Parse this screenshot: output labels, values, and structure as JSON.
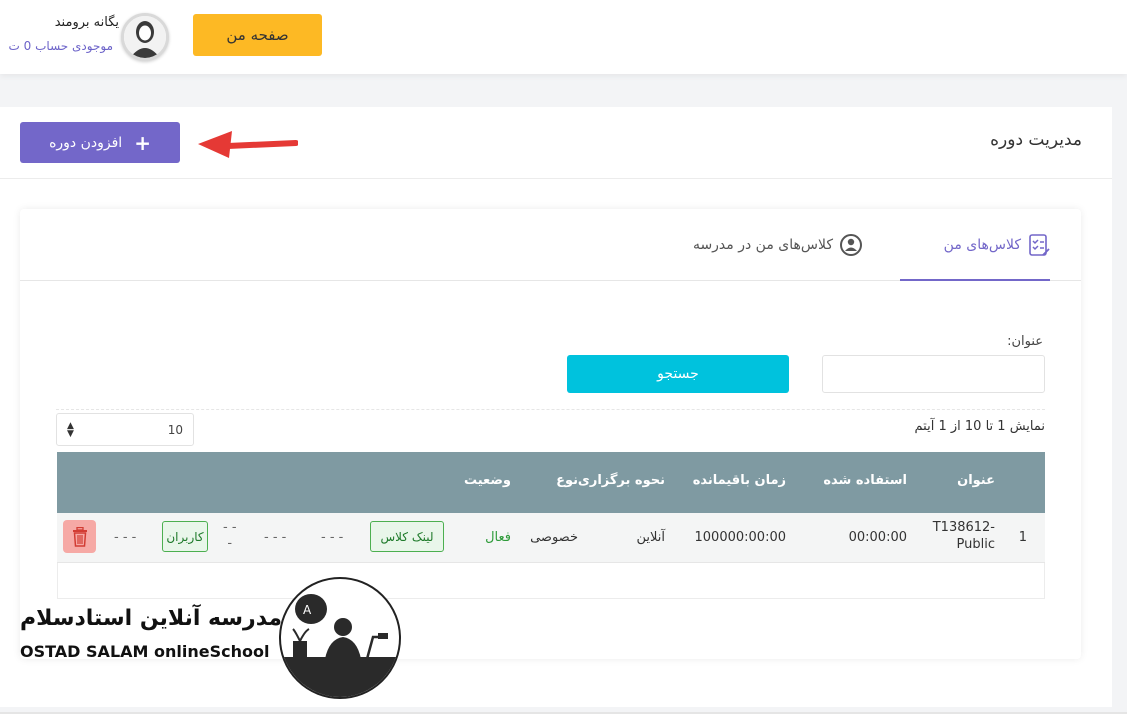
{
  "header": {
    "my_page_label": "صفحه من",
    "user_name": "یگانه برومند",
    "balance_text": "موجودی حساب 0 ت"
  },
  "page": {
    "title": "مدیریت دوره",
    "add_course_label": "افزودن دوره"
  },
  "tabs": [
    {
      "label": "کلاس‌های من",
      "icon": "checklist-icon",
      "active": true
    },
    {
      "label": "کلاس‌های من در مدرسه",
      "icon": "user-circle-icon",
      "active": false
    }
  ],
  "filter": {
    "title_label": "عنوان:",
    "title_value": "",
    "search_label": "جستجو"
  },
  "pager": {
    "page_size": "10",
    "info": "نمایش 1 تا 10 از 1 آیتم"
  },
  "table": {
    "headers": [
      "عنوان",
      "استفاده شده",
      "زمان باقیمانده",
      "نحوه برگزاری",
      "نوع",
      "وضعیت"
    ],
    "rows": [
      {
        "index": "1",
        "title_line1": "T138612-",
        "title_line2": "Public",
        "used": "00:00:00",
        "remaining": "100000:00:00",
        "delivery": "آنلاین",
        "type": "خصوصی",
        "status": "فعال",
        "link_label": "لینک کلاس",
        "dash1": "- - -",
        "dash2": "- - -",
        "dash3_line1": "- -",
        "dash3_line2": "-",
        "users_label": "کاربران",
        "dash4": "- - -"
      }
    ]
  },
  "logo": {
    "name_fa": "مدرسه آنلاین استادسلام",
    "name_en": "OSTAD SALAM onlineSchool"
  },
  "colors": {
    "primary": "#7367c9",
    "accent_yellow": "#fdb924",
    "search_cyan": "#00c2dd",
    "table_header": "#7f9aa2",
    "arrow_red": "#e53935"
  }
}
